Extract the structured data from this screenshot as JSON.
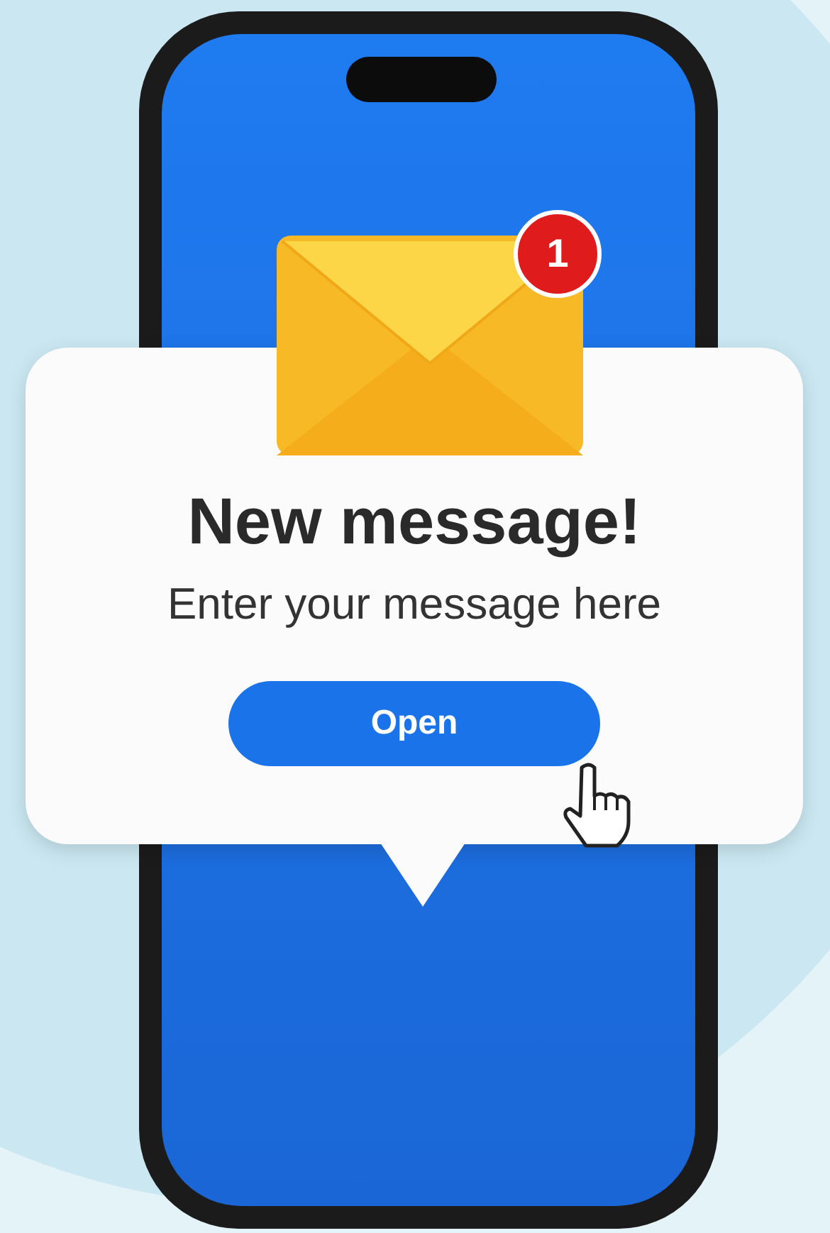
{
  "notification": {
    "badge": "1",
    "title": "New message!",
    "message": "Enter your message here",
    "button": {
      "label": "Open"
    }
  }
}
